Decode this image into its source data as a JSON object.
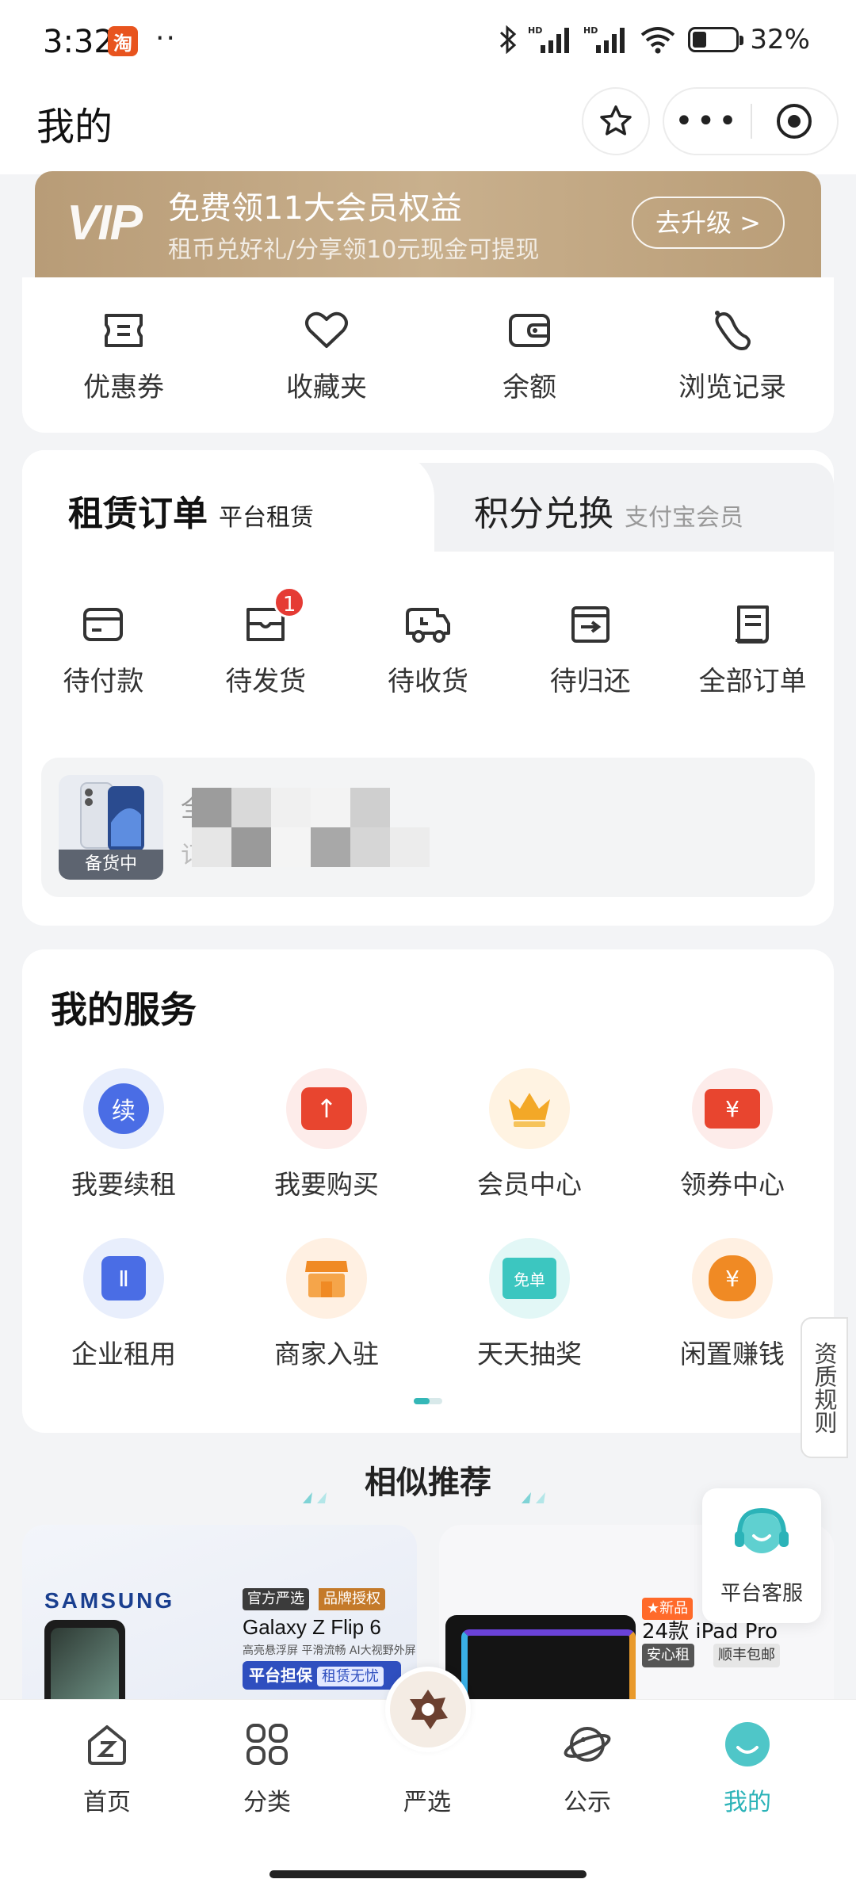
{
  "status_bar": {
    "time": "3:32",
    "app_badge": "淘",
    "dots": "··",
    "battery_percent": "32%",
    "battery_level": 0.32
  },
  "header": {
    "title": "我的"
  },
  "vip": {
    "logo": "VIP",
    "title": "免费领11大会员权益",
    "subtitle": "租币兑好礼/分享领10元现金可提现",
    "button": "去升级 >"
  },
  "quick_links": [
    {
      "label": "优惠券",
      "icon": "ticket-icon"
    },
    {
      "label": "收藏夹",
      "icon": "heart-icon"
    },
    {
      "label": "余额",
      "icon": "wallet-icon"
    },
    {
      "label": "浏览记录",
      "icon": "footprint-icon"
    }
  ],
  "orders": {
    "tab_active_main": "租赁订单",
    "tab_active_sub": "平台租赁",
    "tab_inactive_main": "积分兑换",
    "tab_inactive_sub": "支付宝会员",
    "statuses": [
      {
        "label": "待付款",
        "icon": "card-icon",
        "badge": ""
      },
      {
        "label": "待发货",
        "icon": "package-icon",
        "badge": "1"
      },
      {
        "label": "待收货",
        "icon": "truck-icon",
        "badge": ""
      },
      {
        "label": "待归还",
        "icon": "return-box-icon",
        "badge": ""
      },
      {
        "label": "全部订单",
        "icon": "document-icon",
        "badge": ""
      }
    ],
    "preview_tag": "备货中",
    "preview_line1_char": "全",
    "preview_line2_char": "订"
  },
  "services": {
    "title": "我的服务",
    "items": [
      {
        "label": "我要续租",
        "icon": "renew-icon",
        "bg": "#e8eefc",
        "fg": "#4a6de5",
        "glyph": "续"
      },
      {
        "label": "我要购买",
        "icon": "buy-icon",
        "bg": "#fdecea",
        "fg": "#e8452f",
        "glyph": "↑"
      },
      {
        "label": "会员中心",
        "icon": "crown-icon",
        "bg": "#fff3e2",
        "fg": "#f3a827",
        "glyph": "♛"
      },
      {
        "label": "领券中心",
        "icon": "coupon-icon",
        "bg": "#fdecea",
        "fg": "#e8452f",
        "glyph": "¥"
      },
      {
        "label": "企业租用",
        "icon": "building-icon",
        "bg": "#e8eefc",
        "fg": "#4a6de5",
        "glyph": "Ⅱ"
      },
      {
        "label": "商家入驻",
        "icon": "store-icon",
        "bg": "#fff0e2",
        "fg": "#f08a24",
        "glyph": "▦"
      },
      {
        "label": "天天抽奖",
        "icon": "lottery-icon",
        "bg": "#e2f7f6",
        "fg": "#3cc6c0",
        "glyph": "免单"
      },
      {
        "label": "闲置赚钱",
        "icon": "money-bag-icon",
        "bg": "#fff0e2",
        "fg": "#f08a24",
        "glyph": "¥"
      }
    ]
  },
  "side_tab": "资质规则",
  "recommend": {
    "title": "相似推荐",
    "left": {
      "brand": "SAMSUNG",
      "tag_official": "官方严选",
      "tag_brand": "品牌授权",
      "name": "Galaxy Z Flip 6",
      "desc": "高亮悬浮屏 平滑流畅 AI大视野外屏",
      "guard": "平台担保",
      "guard_tag": "租赁无忧"
    },
    "right": {
      "tag_new": "★新品",
      "name": "24款 iPad Pro",
      "tag_safe": "安心租",
      "tag_sf": "顺丰包邮"
    }
  },
  "customer_service": "平台客服",
  "bottom_nav": [
    {
      "label": "首页",
      "icon": "home-icon",
      "active": false
    },
    {
      "label": "分类",
      "icon": "grid-icon",
      "active": false
    },
    {
      "label": "严选",
      "icon": "flower-icon",
      "active": false
    },
    {
      "label": "公示",
      "icon": "planet-icon",
      "active": false
    },
    {
      "label": "我的",
      "icon": "smile-icon",
      "active": true
    }
  ],
  "colors": {
    "accent": "#2bb3b8",
    "badge": "#e53b34",
    "vip_gold": "#c3a883"
  }
}
